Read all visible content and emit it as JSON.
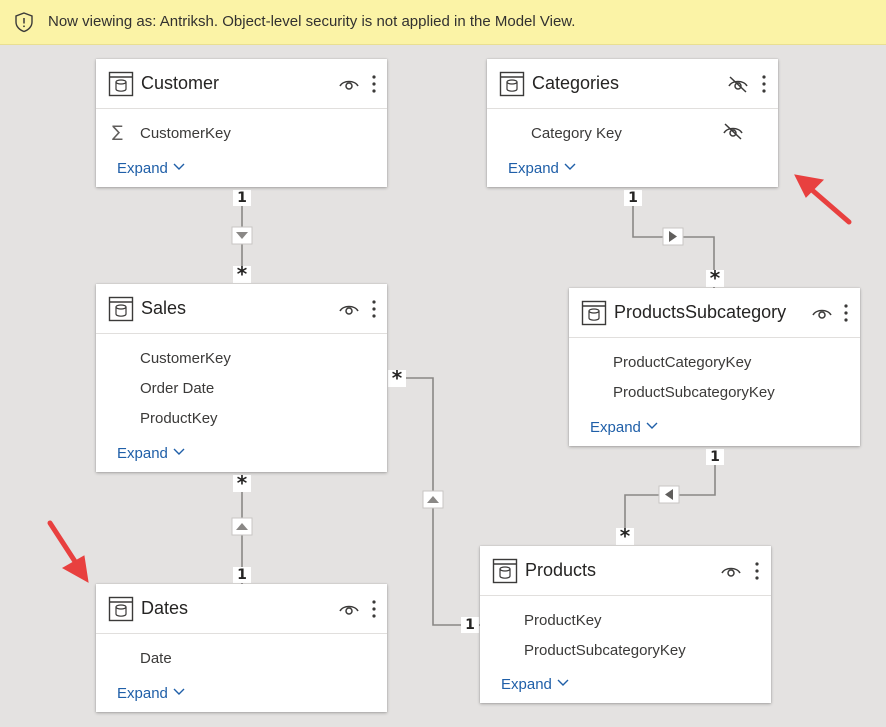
{
  "banner": {
    "icon": "shield-icon",
    "text": "Now viewing as: Antriksh. Object-level security is not applied in the Model View."
  },
  "tables": {
    "customer": {
      "title": "Customer",
      "fields": [
        "CustomerKey"
      ],
      "expand_label": "Expand",
      "visible": true
    },
    "categories": {
      "title": "Categories",
      "fields": [
        "Category Key"
      ],
      "expand_label": "Expand",
      "visible": false
    },
    "sales": {
      "title": "Sales",
      "fields": [
        "CustomerKey",
        "Order Date",
        "ProductKey"
      ],
      "expand_label": "Expand",
      "visible": true
    },
    "products_subcategory": {
      "title": "ProductsSubcategory",
      "fields": [
        "ProductCategoryKey",
        "ProductSubcategoryKey"
      ],
      "expand_label": "Expand",
      "visible": true
    },
    "dates": {
      "title": "Dates",
      "fields": [
        "Date"
      ],
      "expand_label": "Expand",
      "visible": true
    },
    "products": {
      "title": "Products",
      "fields": [
        "ProductKey",
        "ProductSubcategoryKey"
      ],
      "expand_label": "Expand",
      "visible": true
    }
  },
  "relationships": {
    "customer_sales": {
      "from_card": "1",
      "to_card": "*"
    },
    "categories_subcategory": {
      "from_card": "1",
      "to_card": "*"
    },
    "sales_dates": {
      "from_card": "*",
      "to_card": "1"
    },
    "sales_products": {
      "from_card": "*",
      "to_card": "1"
    },
    "subcategory_products": {
      "from_card": "1",
      "to_card": "*"
    }
  },
  "colors": {
    "banner_bg": "#fbf3a6",
    "canvas_bg": "#e4e2e1",
    "link": "#1f5fa8",
    "line": "#8a8886",
    "arrow": "#e8403f"
  }
}
